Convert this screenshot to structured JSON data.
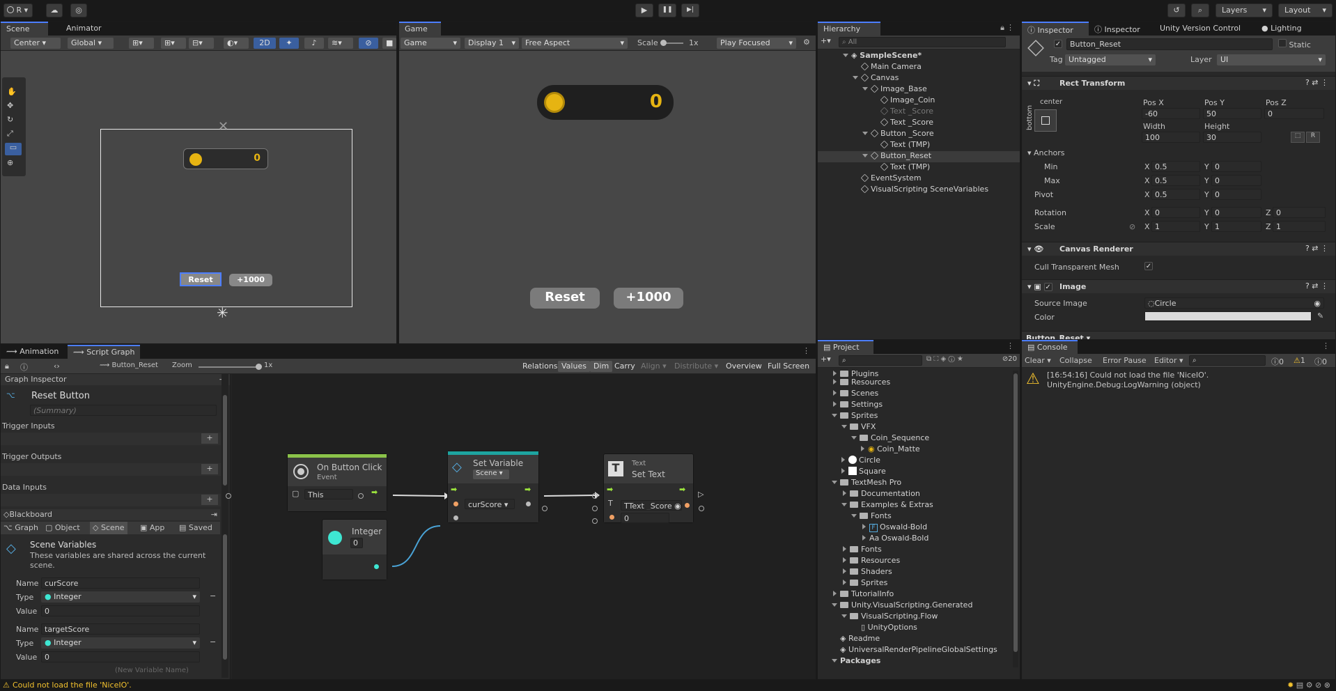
{
  "topbar": {
    "account": "R",
    "play": "▶",
    "pause": "❚❚",
    "step": "▶|",
    "layers": "Layers",
    "layout": "Layout"
  },
  "scene_panel": {
    "tabs": [
      "Scene",
      "Animator"
    ],
    "pivot": "Center",
    "space": "Global",
    "mode2d": "2D",
    "coin_value": "0",
    "btn_reset": "Reset",
    "btn_plus": "+1000"
  },
  "game_panel": {
    "tab": "Game",
    "game_dd": "Game",
    "display": "Display 1",
    "aspect": "Free Aspect",
    "scale_label": "Scale",
    "scale_value": "1x",
    "play_focused": "Play Focused",
    "coin_value": "0",
    "btn_reset": "Reset",
    "btn_plus": "+1000"
  },
  "hierarchy": {
    "tab": "Hierarchy",
    "search_placeholder": "All",
    "items": [
      "SampleScene*",
      "Main Camera",
      "Canvas",
      "Image_Base",
      "Image_Coin",
      "Text _Score",
      "Text _Score",
      "Button _Score",
      "Text (TMP)",
      "Button_Reset",
      "Text (TMP)",
      "EventSystem",
      "VisualScripting SceneVariables"
    ]
  },
  "inspector": {
    "tabs": [
      "Inspector",
      "Inspector",
      "Unity Version Control",
      "Lighting"
    ],
    "object_name": "Button_Reset",
    "static_label": "Static",
    "tag_label": "Tag",
    "tag_value": "Untagged",
    "layer_label": "Layer",
    "layer_value": "UI",
    "rect_title": "Rect Transform",
    "anchor_h": "center",
    "anchor_v": "bottom",
    "posx_label": "Pos X",
    "posx": "-60",
    "posy_label": "Pos Y",
    "posy": "50",
    "posz_label": "Pos Z",
    "posz": "0",
    "width_label": "Width",
    "width": "100",
    "height_label": "Height",
    "height": "30",
    "anchors": "Anchors",
    "min": "Min",
    "max": "Max",
    "min_x": "0.5",
    "min_y": "0",
    "max_x": "0.5",
    "max_y": "0",
    "pivot": "Pivot",
    "pivot_x": "0.5",
    "pivot_y": "0",
    "rotation": "Rotation",
    "rot_x": "0",
    "rot_y": "0",
    "rot_z": "0",
    "scale": "Scale",
    "scale_x": "1",
    "scale_y": "1",
    "scale_z": "1",
    "x": "X",
    "y": "Y",
    "z": "Z",
    "r": "R",
    "canvas_renderer": "Canvas Renderer",
    "cull": "Cull Transparent Mesh",
    "image": "Image",
    "source_image_label": "Source Image",
    "source_image": "Circle",
    "color_label": "Color",
    "footer": "Button_Reset"
  },
  "bottom_left": {
    "tabs": [
      "Animation",
      "Script Graph"
    ],
    "breadcrumb": "Button_Reset",
    "zoom_label": "Zoom",
    "zoom_value": "1x",
    "toolbar": [
      "Relations",
      "Values",
      "Dim",
      "Carry",
      "Align",
      "Distribute",
      "Overview",
      "Full Screen"
    ],
    "graph_inspector": "Graph Inspector",
    "graph_title": "Reset Button",
    "summary_placeholder": "(Summary)",
    "trigger_inputs": "Trigger Inputs",
    "trigger_outputs": "Trigger Outputs",
    "data_inputs": "Data Inputs",
    "blackboard": "Blackboard",
    "bb_tabs": [
      "Graph",
      "Object",
      "Scene",
      "App",
      "Saved"
    ],
    "scene_vars_title": "Scene Variables",
    "scene_vars_desc": "These variables are shared across the current scene.",
    "name_label": "Name",
    "type_label": "Type",
    "value_label": "Value",
    "var1_name": "curScore",
    "var1_type": "Integer",
    "var1_value": "0",
    "var2_name": "targetScore",
    "var2_type": "Integer",
    "var2_value": "0",
    "new_var_placeholder": "(New Variable Name)"
  },
  "graph": {
    "node1_title": "On Button Click",
    "node1_sub": "Event",
    "node1_field": "This",
    "node2_title": "Set Variable",
    "node2_dd": "Scene",
    "node2_field": "curScore",
    "node3_pre": "Text",
    "node3_title": "Set Text",
    "node3_field": "Text _Score",
    "node3_value": "0",
    "node4_title": "Integer",
    "node4_value": "0"
  },
  "project": {
    "tab": "Project",
    "badge": "20",
    "items": [
      "Plugins",
      "Resources",
      "Scenes",
      "Settings",
      "Sprites",
      "VFX",
      "Coin_Sequence",
      "Coin_Matte",
      "Circle",
      "Square",
      "TextMesh Pro",
      "Documentation",
      "Examples & Extras",
      "Fonts",
      "Oswald-Bold",
      "Oswald-Bold",
      "Fonts",
      "Resources",
      "Shaders",
      "Sprites",
      "TutorialInfo",
      "Unity.VisualScripting.Generated",
      "VisualScripting.Flow",
      "UnityOptions",
      "Readme",
      "UniversalRenderPipelineGlobalSettings",
      "Packages"
    ]
  },
  "console": {
    "tab": "Console",
    "toolbar": [
      "Clear",
      "Collapse",
      "Error Pause",
      "Editor"
    ],
    "count_info": "0",
    "count_warn": "1",
    "count_err": "0",
    "msg_line1": "[16:54:16] Could not load the file 'NiceIO'.",
    "msg_line2": "UnityEngine.Debug:LogWarning (object)"
  },
  "statusbar": {
    "message": "Could not load the file 'NiceIO'."
  },
  "colors": {
    "accent": "#4c7eff",
    "warning": "#f2c12e",
    "port_green": "#9be33d",
    "port_orange": "#f0a064",
    "port_cyan": "#3ee6d2",
    "coin": "#e6b412"
  }
}
